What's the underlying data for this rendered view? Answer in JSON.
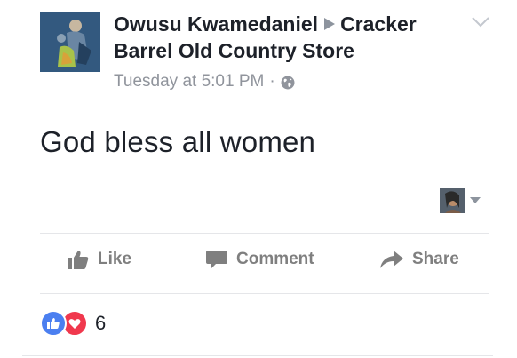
{
  "post": {
    "author": "Owusu Kwamedaniel",
    "place": "Cracker Barrel Old Country Store",
    "time": "Tuesday at 5:01 PM",
    "separator": "·",
    "privacy_icon": "globe-icon",
    "message": "God bless all women"
  },
  "actions": {
    "like": "Like",
    "comment": "Comment",
    "share": "Share"
  },
  "reactions": {
    "types": [
      "like",
      "love"
    ],
    "count": "6"
  },
  "colors": {
    "text": "#1d2129",
    "meta": "#90949c",
    "action": "#7f7f7f",
    "like_blue": "#4b7ff0",
    "love_red": "#f0384d"
  }
}
